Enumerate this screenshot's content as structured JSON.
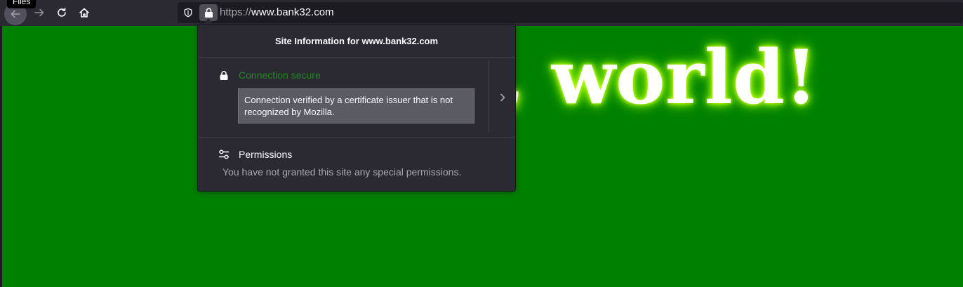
{
  "toolbar": {
    "back_tooltip": "Files",
    "url_scheme": "https://",
    "url_host": "www.bank32.com"
  },
  "page": {
    "heading": "lo, world!"
  },
  "site_info_panel": {
    "title": "Site Information for www.bank32.com",
    "connection_status": "Connection secure",
    "connection_status_color": "#1f8a1f",
    "connection_description": "Connection verified by a certificate issuer that is not recognized by Mozilla.",
    "permissions_title": "Permissions",
    "permissions_description": "You have not granted this site any special permissions."
  },
  "colors": {
    "page_background": "#008000",
    "toolbar_background": "#2b2a33",
    "heading_glow": "#c6ff00"
  },
  "icons": {
    "back": "arrow-left-icon",
    "forward": "arrow-right-icon",
    "reload": "reload-icon",
    "home": "home-icon",
    "tracking_protection": "shield-icon",
    "site_security": "lock-icon",
    "permissions": "sliders-icon",
    "expand": "chevron-right-icon"
  }
}
